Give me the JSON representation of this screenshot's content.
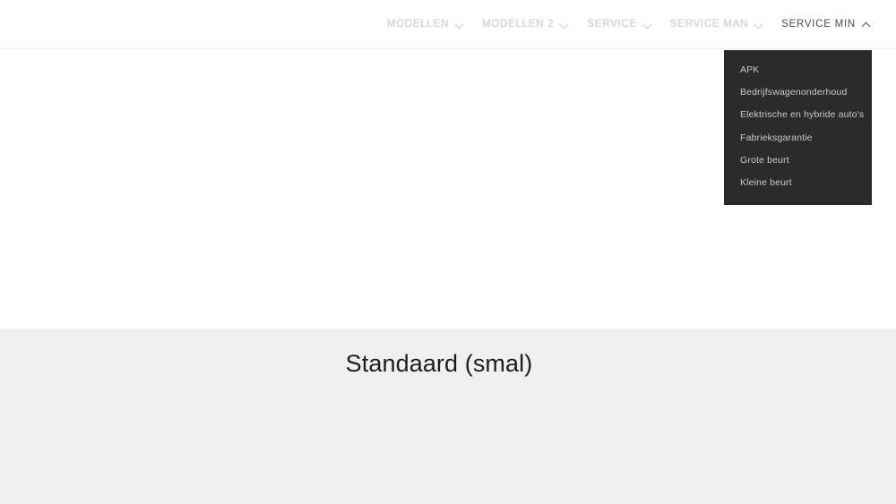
{
  "header": {
    "nav_items": [
      {
        "label": "MODELLEN",
        "icon": "chevron-down-icon",
        "state": "faded"
      },
      {
        "label": "MODELLEN 2",
        "icon": "chevron-down-icon",
        "state": "faded"
      },
      {
        "label": "SERVICE",
        "icon": "chevron-down-icon",
        "state": "faded"
      },
      {
        "label": "SERVICE MAN",
        "icon": "chevron-down-icon",
        "state": "faded"
      },
      {
        "label": "SERVICE MIN",
        "icon": "chevron-up-icon",
        "state": "active"
      }
    ]
  },
  "dropdown": {
    "parent": "SERVICE MIN",
    "background_color": "#2b2b2b",
    "text_color": "#dcdcdc",
    "items": [
      {
        "label": "APK"
      },
      {
        "label": "Bedrijfswagenonderhoud"
      },
      {
        "label": "Elektrische en hybride auto's"
      },
      {
        "label": "Fabrieksgarantie"
      },
      {
        "label": "Grote beurt"
      },
      {
        "label": "Kleine beurt"
      }
    ]
  },
  "main": {
    "section": {
      "heading": "Standaard (smal)",
      "background_color": "#f0f0f0"
    }
  }
}
